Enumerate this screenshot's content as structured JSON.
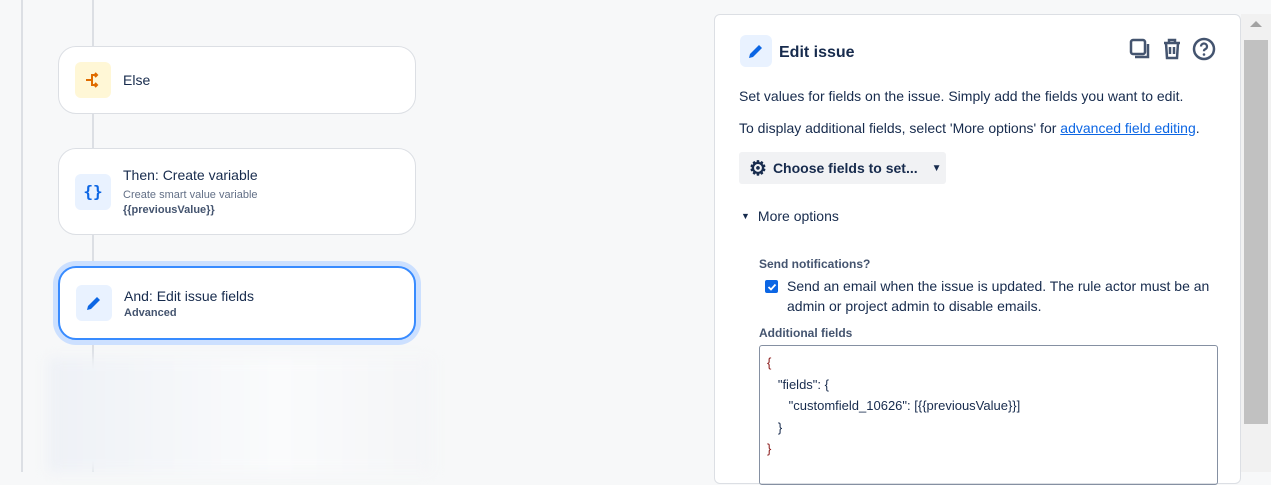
{
  "flow": {
    "else": {
      "title": "Else"
    },
    "create_variable": {
      "title": "Then: Create variable",
      "subtitle": "Create smart value variable",
      "value": "{{previousValue}}"
    },
    "edit_fields": {
      "title": "And: Edit issue fields",
      "subtitle": "Advanced"
    }
  },
  "panel": {
    "title": "Edit issue",
    "description": "Set values for fields on the issue. Simply add the fields you want to edit.",
    "more_text": "To display additional fields, select 'More options' for ",
    "more_link": "advanced field editing",
    "more_suffix": ".",
    "choose_button": "Choose fields to set...",
    "more_options": "More options",
    "send_notifications_label": "Send notifications?",
    "send_email_text": "Send an email when the issue is updated. The rule actor must be an admin or project admin to disable emails.",
    "send_email_checked": true,
    "additional_fields_label": "Additional fields",
    "code": {
      "l1": "{",
      "l2": "   \"fields\": {",
      "l3": "      \"customfield_10626\": [{{previousValue}}]",
      "l4": "   }",
      "l5": "}"
    }
  },
  "colors": {
    "accent": "#0c66e4",
    "selected_border": "#388bff"
  }
}
